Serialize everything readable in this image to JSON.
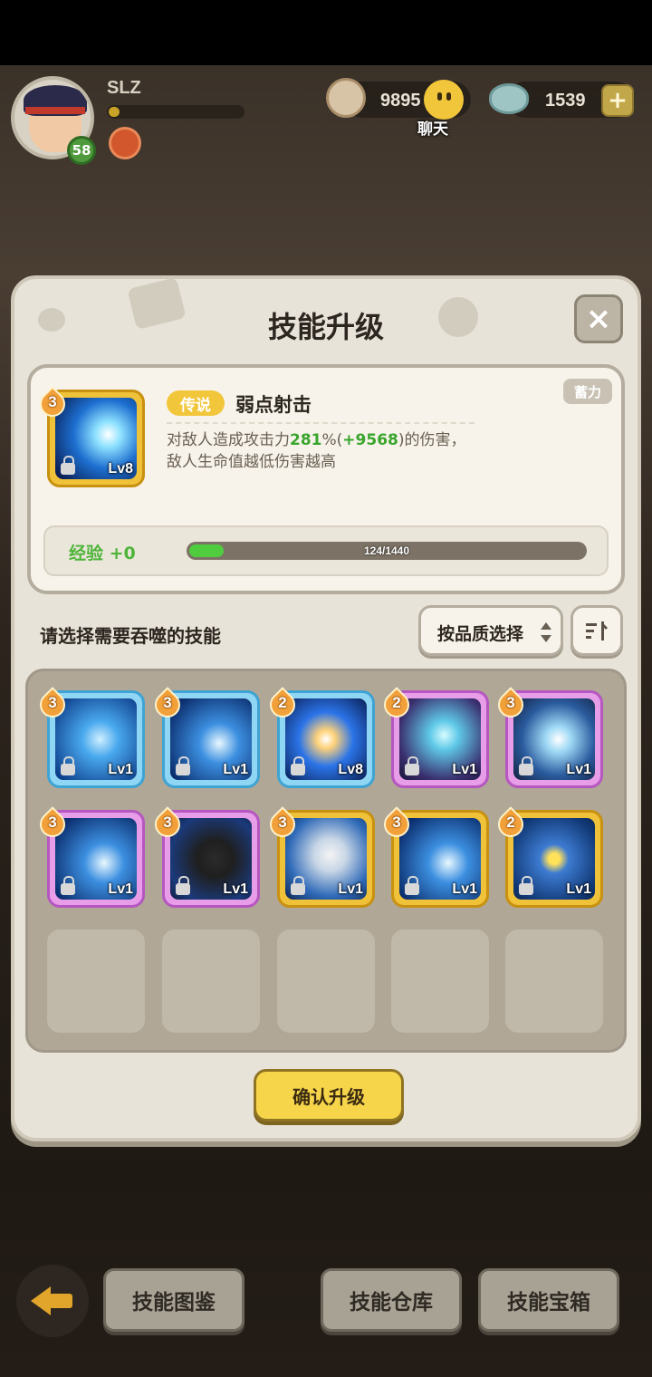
{
  "player": {
    "name": "SLZ",
    "level": "58",
    "xp_progress": 0.08
  },
  "resources": {
    "shells": "9895",
    "gems": "1539",
    "chat_label": "聊天"
  },
  "modal": {
    "title": "技能升级"
  },
  "selected_skill": {
    "stars": "3",
    "level": "Lv8",
    "quality": "传说",
    "name": "弱点射击",
    "tag": "蓄力",
    "desc_pre": "对敌人造成攻击力",
    "desc_pct": "281",
    "desc_mid": "%(",
    "desc_bonus": "+9568",
    "desc_post": ")的伤害，",
    "desc_line2": "敌人生命值越低伤害越高"
  },
  "experience": {
    "label": "经验",
    "gain": "+0",
    "current": 124,
    "max": 1440,
    "text": "124/1440"
  },
  "selection": {
    "prompt": "请选择需要吞噬的技能",
    "filter_label": "按品质选择"
  },
  "skills": [
    {
      "stars": "3",
      "level": "Lv1",
      "frame": "blue"
    },
    {
      "stars": "3",
      "level": "Lv1",
      "frame": "blue"
    },
    {
      "stars": "2",
      "level": "Lv8",
      "frame": "blue"
    },
    {
      "stars": "2",
      "level": "Lv1",
      "frame": "purple"
    },
    {
      "stars": "3",
      "level": "Lv1",
      "frame": "purple"
    },
    {
      "stars": "3",
      "level": "Lv1",
      "frame": "purple"
    },
    {
      "stars": "3",
      "level": "Lv1",
      "frame": "purple"
    },
    {
      "stars": "3",
      "level": "Lv1",
      "frame": "gold"
    },
    {
      "stars": "3",
      "level": "Lv1",
      "frame": "gold"
    },
    {
      "stars": "2",
      "level": "Lv1",
      "frame": "gold"
    }
  ],
  "confirm_label": "确认升级",
  "bottom_nav": {
    "codex": "技能图鉴",
    "warehouse": "技能仓库",
    "chest": "技能宝箱"
  },
  "colors": {
    "gold_frame": "#f0c23a",
    "blue_frame": "#8fd6f5",
    "purple_frame": "#e79de8",
    "exp_green": "#4fcd3f",
    "highlight_green": "#3aa52d"
  }
}
